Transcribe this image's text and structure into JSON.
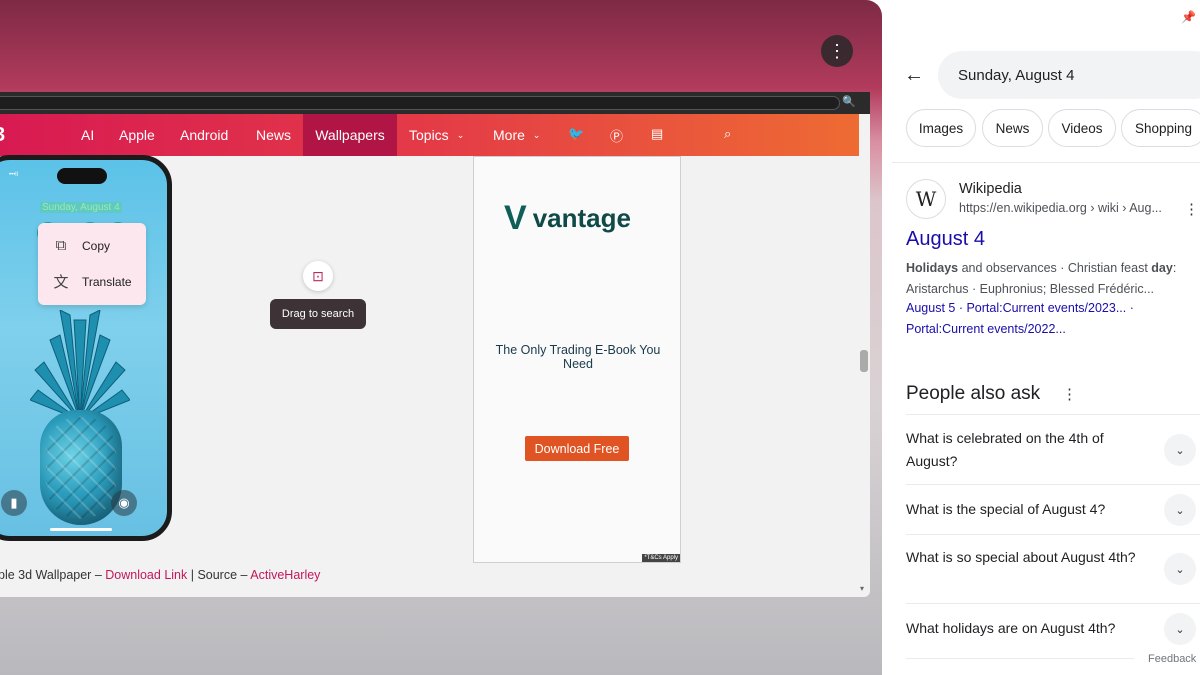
{
  "left": {
    "nav": {
      "items": [
        "AI",
        "Apple",
        "Android",
        "News",
        "Wallpapers",
        "Topics",
        "More"
      ],
      "active": "Wallpapers"
    },
    "phone": {
      "date": "Sunday, August 4"
    },
    "context_menu": {
      "copy": "Copy",
      "translate": "Translate"
    },
    "lens_tooltip": "Drag to search",
    "ad": {
      "brand": "vantage",
      "tagline": "The Only Trading E-Book You Need",
      "cta": "Download Free",
      "tcs": "*T&Cs Apply"
    },
    "caption": {
      "prefix": "ple 3d Wallpaper – ",
      "link1": "Download Link",
      "mid": " | Source – ",
      "link2": "ActiveHarley"
    }
  },
  "panel": {
    "search_value": "Sunday, August 4",
    "chips": [
      "Images",
      "News",
      "Videos",
      "Shopping"
    ],
    "result": {
      "source_name": "Wikipedia",
      "source_url": "https://en.wikipedia.org › wiki › Aug...",
      "title": "August 4",
      "snippet_bold1": "Holidays",
      "snippet_part1": " and observances · Christian feast ",
      "snippet_bold2": "day",
      "snippet_part2": ": Aristarchus · Euphronius; Blessed Frédéric...",
      "links": "August 5 · Portal:Current events/2023... · Portal:Current events/2022..."
    },
    "paa": {
      "title": "People also ask",
      "questions": [
        "What is celebrated on the 4th of August?",
        "What is the special of August 4?",
        "What is so special about August 4th?",
        "What holidays are on August 4th?"
      ]
    },
    "feedback": "Feedback"
  },
  "colors": {
    "nav_gradient_start": "#d81a52",
    "nav_gradient_end": "#ee6b33",
    "nav_active": "#b01545",
    "link_blue": "#1a0dab",
    "ad_cta": "#e05323"
  },
  "icons": [
    "more-vert-icon",
    "search-icon",
    "twitter-icon",
    "pinterest-icon",
    "rss-icon",
    "copy-icon",
    "translate-icon",
    "lens-icon",
    "back-arrow-icon",
    "pin-icon",
    "chevron-down-icon",
    "flashlight-icon",
    "camera-icon"
  ]
}
